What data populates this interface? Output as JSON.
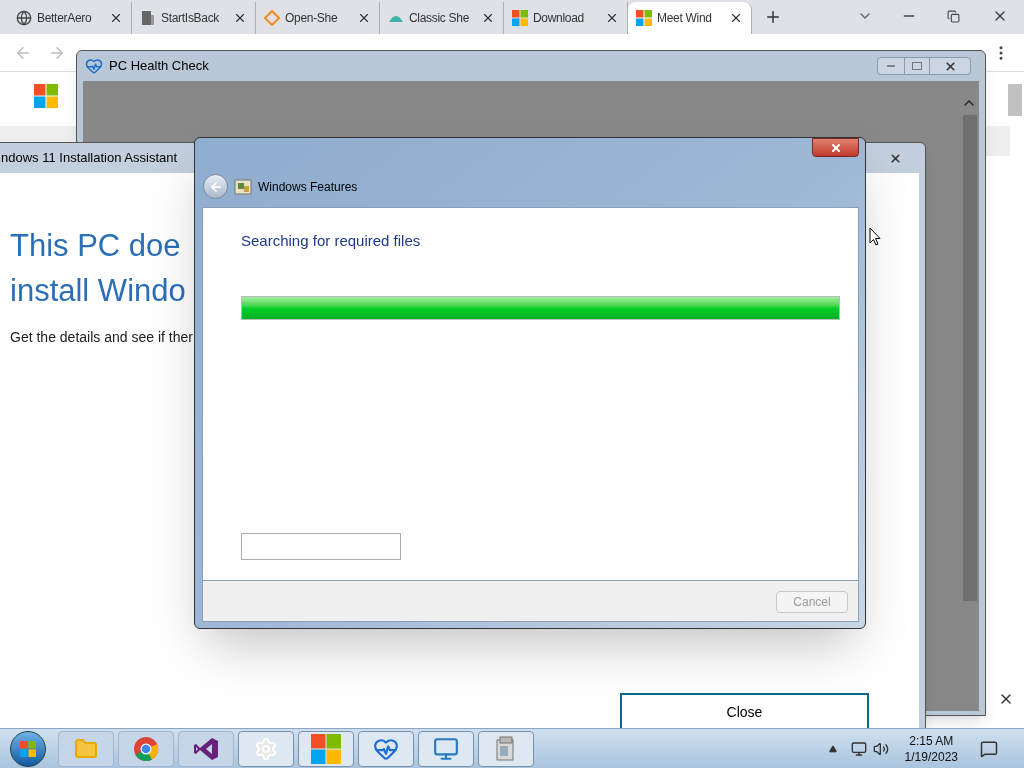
{
  "browser": {
    "tabs": [
      {
        "title": "BetterAero",
        "selected": false
      },
      {
        "title": "StartIsBack",
        "selected": false
      },
      {
        "title": "Open-She",
        "selected": false
      },
      {
        "title": "Classic She",
        "selected": false
      },
      {
        "title": "Download",
        "selected": false
      },
      {
        "title": "Meet Wind",
        "selected": true
      }
    ]
  },
  "health_check": {
    "title": "PC Health Check"
  },
  "install_assistant": {
    "title": "ndows 11 Installation Assistant",
    "heading_lines": [
      "This PC doe",
      "install Windo"
    ],
    "body": "Get the details and see if ther",
    "close_button": "Close"
  },
  "features": {
    "title": "Windows Features",
    "status": "Searching for required files",
    "progress": {
      "level": 1
    },
    "cancel": {
      "label": "Cancel",
      "disabled": true
    }
  },
  "taskbar": {
    "clock": {
      "time": "2:15 AM",
      "date": "1/19/2023"
    }
  }
}
